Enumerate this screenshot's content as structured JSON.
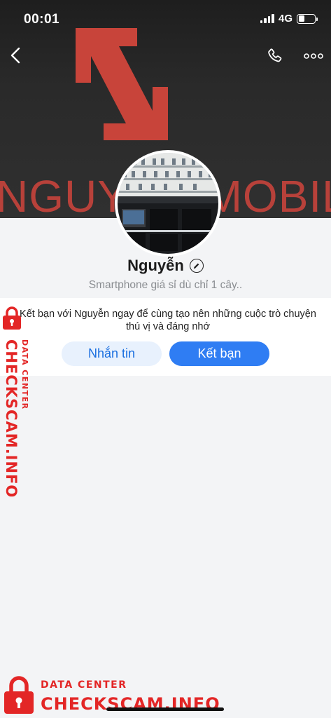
{
  "status_bar": {
    "time": "00:01",
    "network": "4G",
    "battery_level": 0.4
  },
  "header": {
    "back_icon": "chevron-left-icon",
    "call_icon": "phone-icon",
    "more_icon": "more-horizontal-icon"
  },
  "cover": {
    "wordmark": "NGUYỄN MOBILE",
    "brand_color": "#c8443a"
  },
  "profile": {
    "name": "Nguyễn",
    "bio": "Smartphone giá sỉ dù chỉ 1 cây.."
  },
  "invite": {
    "text": "Kết bạn với Nguyễn ngay để cùng tạo nên những cuộc trò chuyện thú vị và đáng nhớ",
    "message_label": "Nhắn tin",
    "add_friend_label": "Kết bạn"
  },
  "watermark": {
    "big": "CHECKSCAM.INFO",
    "small": "DATA CENTER",
    "color": "#e32626"
  },
  "colors": {
    "accent": "#2f7df3",
    "accent_light": "#e8f1fd",
    "background": "#f3f4f6"
  }
}
